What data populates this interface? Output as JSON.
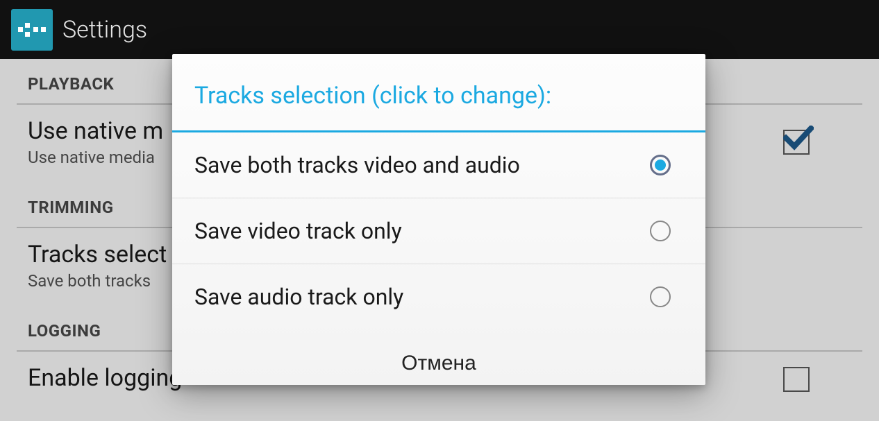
{
  "header": {
    "title": "Settings"
  },
  "sections": {
    "playback": {
      "label": "PLAYBACK",
      "item": {
        "title": "Use native m",
        "subtitle": "Use native media",
        "checked": true
      }
    },
    "trimming": {
      "label": "TRIMMING",
      "item": {
        "title": "Tracks select",
        "subtitle": "Save both tracks"
      }
    },
    "logging": {
      "label": "LOGGING",
      "item": {
        "title": "Enable logging",
        "checked": false
      }
    }
  },
  "dialog": {
    "title": "Tracks selection (click to change):",
    "options": [
      {
        "label": "Save both tracks video and audio",
        "selected": true
      },
      {
        "label": "Save video track only",
        "selected": false
      },
      {
        "label": "Save audio track only",
        "selected": false
      }
    ],
    "cancel": "Отмена"
  }
}
